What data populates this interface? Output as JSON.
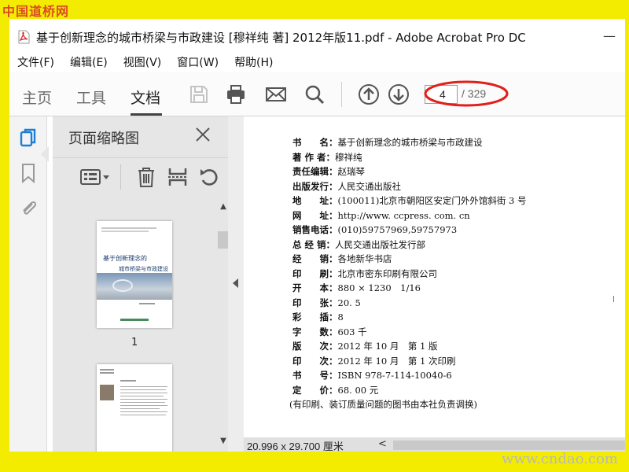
{
  "watermarks": {
    "top": "中国道桥网",
    "bottom": "www.cndao.com"
  },
  "window": {
    "title": "基于创新理念的城市桥梁与市政建设 [穆祥纯 著] 2012年版11.pdf - Adobe Acrobat Pro DC",
    "minimize": "—"
  },
  "menu": [
    "文件(F)",
    "编辑(E)",
    "视图(V)",
    "窗口(W)",
    "帮助(H)"
  ],
  "nav_tabs": [
    "主页",
    "工具",
    "文档"
  ],
  "active_tab": "文档",
  "toolbar": {
    "icons": [
      "save-icon",
      "print-icon",
      "email-icon",
      "search-icon",
      "prev-page-icon",
      "next-page-icon"
    ],
    "page_current": "4",
    "page_total": "/ 329",
    "highlight_color": "#e0201b"
  },
  "rail": {
    "icons": [
      "page-thumbnails-icon",
      "bookmark-icon",
      "attachment-icon"
    ]
  },
  "thumbnail_panel": {
    "title": "页面缩略图",
    "tools": [
      "thumbnail-options-icon",
      "delete-icon",
      "extract-icon",
      "rotate-icon"
    ],
    "thumbnails": [
      {
        "label": "1",
        "title_line1": "基于创新理念的",
        "title_line2": "城市桥梁与市政建设"
      },
      {
        "label": ""
      }
    ]
  },
  "document": {
    "lines": [
      {
        "key": "书　　名：",
        "value": "基于创新理念的城市桥梁与市政建设"
      },
      {
        "key": "著 作 者：",
        "value": "穆祥纯"
      },
      {
        "key": "责任编辑：",
        "value": "赵瑞琴"
      },
      {
        "key": "出版发行：",
        "value": "人民交通出版社"
      },
      {
        "key": "地　　址：",
        "value": "(100011)北京市朝阳区安定门外外馆斜街 3 号"
      },
      {
        "key": "网　　址：",
        "value": "http://www. ccpress. com. cn"
      },
      {
        "key": "销售电话：",
        "value": "(010)59757969,59757973"
      },
      {
        "key": "总 经 销：",
        "value": "人民交通出版社发行部"
      },
      {
        "key": "经　　销：",
        "value": "各地新华书店"
      },
      {
        "key": "印　　刷：",
        "value": "北京市密东印刷有限公司"
      },
      {
        "key": "开　　本：",
        "value": "880 × 1230　1/16"
      },
      {
        "key": "印　　张：",
        "value": "20. 5"
      },
      {
        "key": "彩　　插：",
        "value": "8"
      },
      {
        "key": "字　　数：",
        "value": "603 千"
      },
      {
        "key": "版　　次：",
        "value": "2012 年 10 月　第 1 版"
      },
      {
        "key": "印　　次：",
        "value": "2012 年 10 月　第 1 次印刷"
      },
      {
        "key": "书　　号：",
        "value": "ISBN 978-7-114-10040-6"
      },
      {
        "key": "定　　价：",
        "value": "68. 00 元"
      }
    ],
    "footnote": "(有印刷、装订质量问题的图书由本社负责调换)"
  },
  "status": {
    "page_size": "20.996 x 29.700 厘米",
    "scroll_left": "<"
  }
}
